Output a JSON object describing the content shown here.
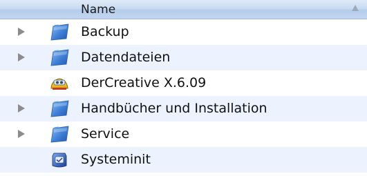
{
  "columns": {
    "name_header": "Name",
    "sort_direction": "ascending"
  },
  "rows": [
    {
      "label": "Backup",
      "kind": "folder",
      "expandable": true,
      "icon": "folder-icon"
    },
    {
      "label": "Datendateien",
      "kind": "folder",
      "expandable": true,
      "icon": "folder-icon"
    },
    {
      "label": "DerCreative X.6.09",
      "kind": "application",
      "expandable": false,
      "icon": "app-icon"
    },
    {
      "label": "Handbücher und Installation",
      "kind": "folder",
      "expandable": true,
      "icon": "folder-icon"
    },
    {
      "label": "Service",
      "kind": "folder",
      "expandable": true,
      "icon": "folder-icon"
    },
    {
      "label": "Systeminit",
      "kind": "application",
      "expandable": false,
      "icon": "app-icon"
    }
  ],
  "colors": {
    "header_top": "#dfeaf8",
    "header_bottom": "#b4cdec",
    "stripe": "#edf3fe",
    "folder_blue": "#4a88d8"
  }
}
